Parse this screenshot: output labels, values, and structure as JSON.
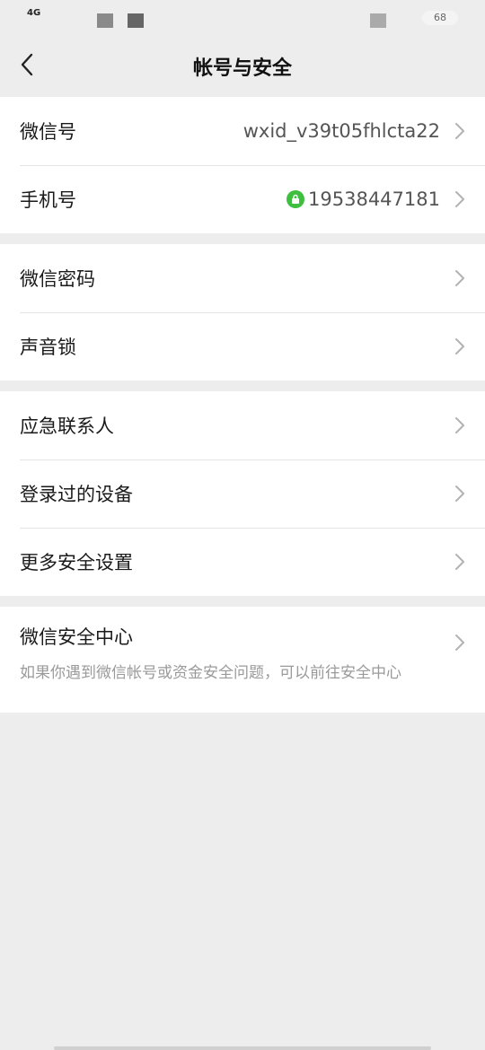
{
  "status_bar": {
    "network": "4G",
    "battery": "68"
  },
  "nav": {
    "title": "帐号与安全",
    "back_icon": "chevron-left-icon"
  },
  "group1": [
    {
      "label": "微信号",
      "value": "wxid_v39t05fhlcta22"
    },
    {
      "label": "手机号",
      "value": "19538447181",
      "verified_icon": "lock-icon"
    }
  ],
  "group2": [
    {
      "label": "微信密码"
    },
    {
      "label": "声音锁"
    }
  ],
  "group3": [
    {
      "label": "应急联系人"
    },
    {
      "label": "登录过的设备"
    },
    {
      "label": "更多安全设置"
    }
  ],
  "group4": {
    "label": "微信安全中心",
    "description": "如果你遇到微信帐号或资金安全问题，可以前往安全中心"
  },
  "colors": {
    "background": "#ededed",
    "card": "#ffffff",
    "lock_green": "#3fbf3f",
    "secondary_text": "#9a9a9a"
  }
}
